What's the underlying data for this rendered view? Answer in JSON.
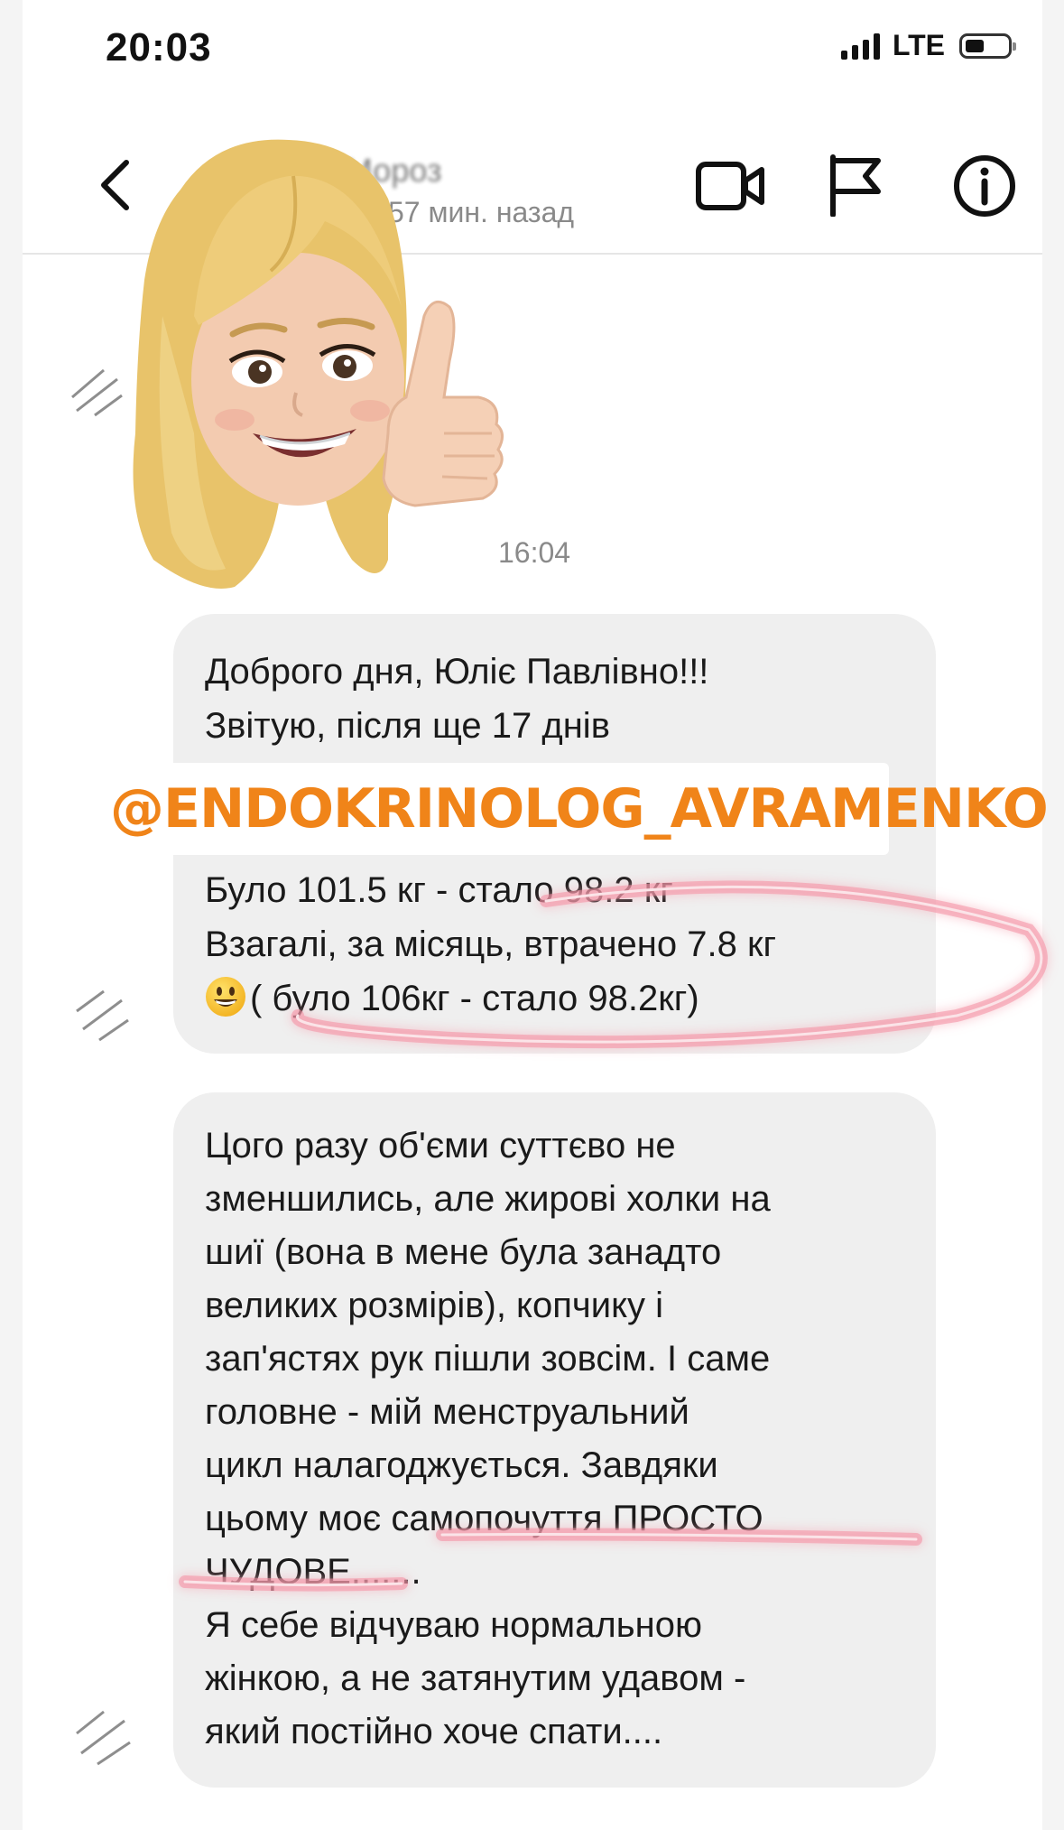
{
  "status_bar": {
    "time": "20:03",
    "network": "LTE",
    "battery_level": 0.45
  },
  "header": {
    "contact_name": "іна Мороз",
    "last_active": "57 мин. назад",
    "icons": [
      "chevron-left-icon",
      "video-call-icon",
      "flag-icon",
      "info-icon"
    ]
  },
  "sticker": {
    "time": "16:04"
  },
  "message1": {
    "lines": [
      "Доброго дня, Юліє Павлівно!!!",
      "Звітую, після ще 17 днів",
      "Було 101.5 кг - стало 98.2 кг",
      "Взагалі, за місяць, втрачено 7.8 кг",
      "( було 106кг - стало 98.2кг)"
    ]
  },
  "watermark": "@ENDOKRINOLOG_AVRAMENKO",
  "message2": {
    "lines": [
      "Цого разу об'єми суттєво не",
      "зменшились, але жирові холки на",
      "шиї (вона в мене була занадто",
      "великих розмірів), копчику і",
      "зап'ястях рук пішли зовсім. І саме",
      "головне - мій менструальний",
      "цикл налагоджується. Завдяки",
      "цьому моє самопочуття ПРОСТО",
      "ЧУДОВЕ.......",
      "Я себе відчуваю нормальною",
      "жінкою, а не затянутим удавом -",
      "який постійно хоче спати...."
    ]
  },
  "colors": {
    "watermark": "#f08419",
    "highlight": "#e8546f",
    "bubble": "#efefef",
    "timestamp": "#8a8a8a"
  }
}
